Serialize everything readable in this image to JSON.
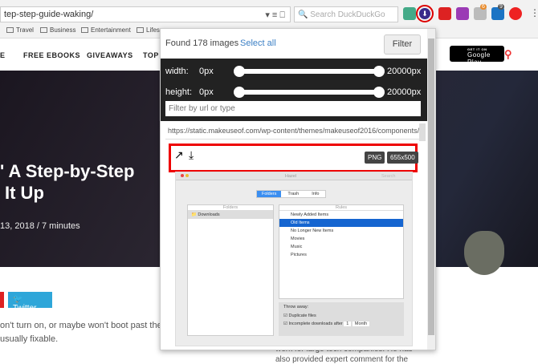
{
  "browser": {
    "url": "tep-step-guide-waking/",
    "search_placeholder": "Search DuckDuckGo",
    "ext_badges": [
      "6",
      "9"
    ],
    "bookmarks": [
      "Travel",
      "Business",
      "Entertainment",
      "Lifes"
    ]
  },
  "site": {
    "nav": [
      "E",
      "FREE EBOOKS",
      "GIVEAWAYS",
      "TOP"
    ],
    "store_small": "GET IT ON",
    "store": "Google Play",
    "title_line1": "' A Step-by-Step",
    "title_line2": "It Up",
    "date": "13, 2018  /  7 minutes",
    "twitter": "Twitter",
    "body1": "on't turn on, or maybe won't boot past the",
    "body2": "usually fixable.",
    "side1": "work for large tech companies. He has",
    "side2": "also provided expert comment for the"
  },
  "popup": {
    "found": "Found 178 images",
    "select_all": "Select all",
    "filter": "Filter",
    "width_label": "width:",
    "width_min": "0px",
    "width_max": "20000px",
    "height_label": "height:",
    "height_min": "0px",
    "height_max": "20000px",
    "filter_placeholder": "Filter by url or type",
    "url": "https://static.makeuseof.com/wp-content/themes/makeuseof2016/components/i",
    "type": "PNG",
    "size": "655x500"
  },
  "hazel": {
    "title": "Hazel",
    "search": "Search",
    "tabs": [
      "Folders",
      "Trash",
      "Info"
    ],
    "folders_header": "Folders",
    "folder": "Downloads",
    "rules_header": "Rules",
    "rules": [
      "Newly Added Items",
      "Old Items",
      "No Longer New Items",
      "Movies",
      "Music",
      "Pictures"
    ],
    "throw_away": "Throw away:",
    "dup": "Duplicate files",
    "incomplete": "Incomplete downloads after",
    "num": "1",
    "unit": "Month"
  }
}
